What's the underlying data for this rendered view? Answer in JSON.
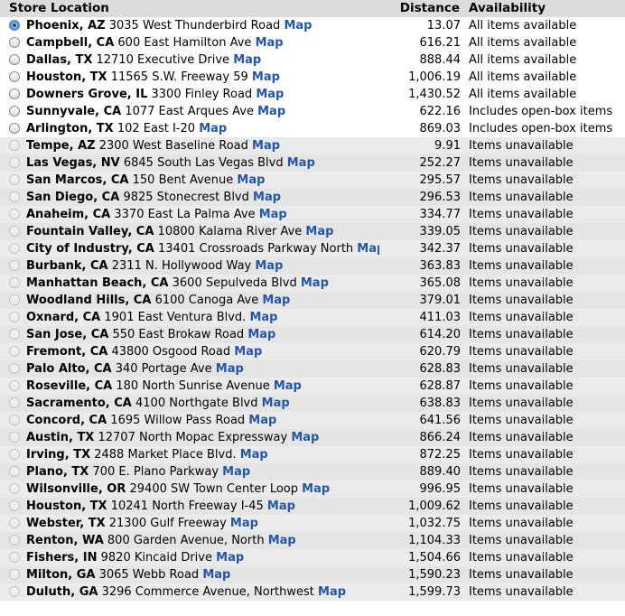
{
  "headers": {
    "store": "Store Location",
    "distance": "Distance",
    "availability": "Availability"
  },
  "map_label": "Map",
  "colors": {
    "link": "#2356a8",
    "header_bg": "#dcdcdc",
    "unavailable_bg": "#e8e8e8"
  },
  "stores": [
    {
      "city": "Phoenix, AZ",
      "address": "3035 West Thunderbird Road",
      "distance": "13.07",
      "availability": "All items available",
      "status": "available",
      "selected": true
    },
    {
      "city": "Campbell, CA",
      "address": "600 East Hamilton Ave",
      "distance": "616.21",
      "availability": "All items available",
      "status": "available",
      "selected": false
    },
    {
      "city": "Dallas, TX",
      "address": "12710 Executive Drive",
      "distance": "888.44",
      "availability": "All items available",
      "status": "available",
      "selected": false
    },
    {
      "city": "Houston, TX",
      "address": "11565 S.W. Freeway 59",
      "distance": "1,006.19",
      "availability": "All items available",
      "status": "available",
      "selected": false
    },
    {
      "city": "Downers Grove, IL",
      "address": "3300 Finley Road",
      "distance": "1,430.52",
      "availability": "All items available",
      "status": "available",
      "selected": false
    },
    {
      "city": "Sunnyvale, CA",
      "address": "1077 East Arques Ave",
      "distance": "622.16",
      "availability": "Includes open-box items",
      "status": "available",
      "selected": false
    },
    {
      "city": "Arlington, TX",
      "address": "102 East I-20",
      "distance": "869.03",
      "availability": "Includes open-box items",
      "status": "available",
      "selected": false
    },
    {
      "city": "Tempe, AZ",
      "address": "2300 West Baseline Road",
      "distance": "9.91",
      "availability": "Items unavailable",
      "status": "unavailable",
      "selected": false
    },
    {
      "city": "Las Vegas, NV",
      "address": "6845 South Las Vegas Blvd",
      "distance": "252.27",
      "availability": "Items unavailable",
      "status": "unavailable",
      "selected": false
    },
    {
      "city": "San Marcos, CA",
      "address": "150 Bent Avenue",
      "distance": "295.57",
      "availability": "Items unavailable",
      "status": "unavailable",
      "selected": false
    },
    {
      "city": "San Diego, CA",
      "address": "9825 Stonecrest Blvd",
      "distance": "296.53",
      "availability": "Items unavailable",
      "status": "unavailable",
      "selected": false
    },
    {
      "city": "Anaheim, CA",
      "address": "3370 East La Palma Ave",
      "distance": "334.77",
      "availability": "Items unavailable",
      "status": "unavailable",
      "selected": false
    },
    {
      "city": "Fountain Valley, CA",
      "address": "10800 Kalama River Ave",
      "distance": "339.05",
      "availability": "Items unavailable",
      "status": "unavailable",
      "selected": false
    },
    {
      "city": "City of Industry, CA",
      "address": "13401 Crossroads Parkway North",
      "distance": "342.37",
      "availability": "Items unavailable",
      "status": "unavailable",
      "selected": false
    },
    {
      "city": "Burbank, CA",
      "address": "2311 N. Hollywood Way",
      "distance": "363.83",
      "availability": "Items unavailable",
      "status": "unavailable",
      "selected": false
    },
    {
      "city": "Manhattan Beach, CA",
      "address": "3600 Sepulveda Blvd",
      "distance": "365.08",
      "availability": "Items unavailable",
      "status": "unavailable",
      "selected": false
    },
    {
      "city": "Woodland Hills, CA",
      "address": "6100 Canoga Ave",
      "distance": "379.01",
      "availability": "Items unavailable",
      "status": "unavailable",
      "selected": false
    },
    {
      "city": "Oxnard, CA",
      "address": "1901 East Ventura Blvd.",
      "distance": "411.03",
      "availability": "Items unavailable",
      "status": "unavailable",
      "selected": false
    },
    {
      "city": "San Jose, CA",
      "address": "550 East Brokaw Road",
      "distance": "614.20",
      "availability": "Items unavailable",
      "status": "unavailable",
      "selected": false
    },
    {
      "city": "Fremont, CA",
      "address": "43800 Osgood Road",
      "distance": "620.79",
      "availability": "Items unavailable",
      "status": "unavailable",
      "selected": false
    },
    {
      "city": "Palo Alto, CA",
      "address": "340 Portage Ave",
      "distance": "628.83",
      "availability": "Items unavailable",
      "status": "unavailable",
      "selected": false
    },
    {
      "city": "Roseville, CA",
      "address": "180 North Sunrise Avenue",
      "distance": "628.87",
      "availability": "Items unavailable",
      "status": "unavailable",
      "selected": false
    },
    {
      "city": "Sacramento, CA",
      "address": "4100 Northgate Blvd",
      "distance": "638.83",
      "availability": "Items unavailable",
      "status": "unavailable",
      "selected": false
    },
    {
      "city": "Concord, CA",
      "address": "1695 Willow Pass Road",
      "distance": "641.56",
      "availability": "Items unavailable",
      "status": "unavailable",
      "selected": false
    },
    {
      "city": "Austin, TX",
      "address": "12707 North Mopac Expressway",
      "distance": "866.24",
      "availability": "Items unavailable",
      "status": "unavailable",
      "selected": false
    },
    {
      "city": "Irving, TX",
      "address": "2488 Market Place Blvd.",
      "distance": "872.25",
      "availability": "Items unavailable",
      "status": "unavailable",
      "selected": false
    },
    {
      "city": "Plano, TX",
      "address": "700 E. Plano Parkway",
      "distance": "889.40",
      "availability": "Items unavailable",
      "status": "unavailable",
      "selected": false
    },
    {
      "city": "Wilsonville, OR",
      "address": "29400 SW Town Center Loop",
      "distance": "996.95",
      "availability": "Items unavailable",
      "status": "unavailable",
      "selected": false
    },
    {
      "city": "Houston, TX",
      "address": "10241 North Freeway I-45",
      "distance": "1,009.62",
      "availability": "Items unavailable",
      "status": "unavailable",
      "selected": false
    },
    {
      "city": "Webster, TX",
      "address": "21300 Gulf Freeway",
      "distance": "1,032.75",
      "availability": "Items unavailable",
      "status": "unavailable",
      "selected": false
    },
    {
      "city": "Renton, WA",
      "address": "800 Garden Avenue, North",
      "distance": "1,104.33",
      "availability": "Items unavailable",
      "status": "unavailable",
      "selected": false
    },
    {
      "city": "Fishers, IN",
      "address": "9820 Kincaid Drive",
      "distance": "1,504.66",
      "availability": "Items unavailable",
      "status": "unavailable",
      "selected": false
    },
    {
      "city": "Milton, GA",
      "address": "3065 Webb Road",
      "distance": "1,590.23",
      "availability": "Items unavailable",
      "status": "unavailable",
      "selected": false
    },
    {
      "city": "Duluth, GA",
      "address": "3296 Commerce Avenue, Northwest",
      "distance": "1,599.73",
      "availability": "Items unavailable",
      "status": "unavailable",
      "selected": false
    }
  ]
}
